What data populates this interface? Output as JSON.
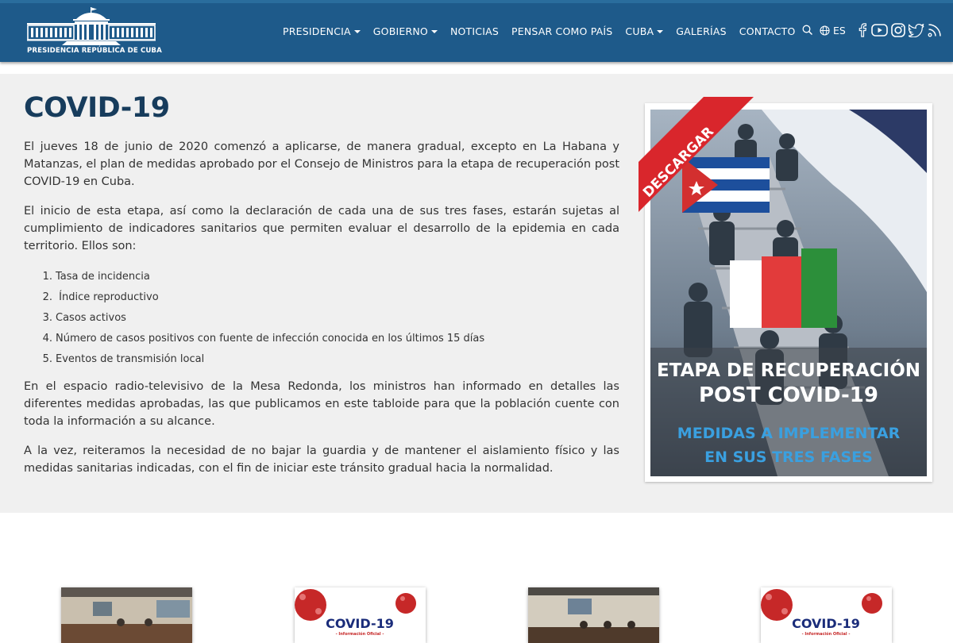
{
  "header": {
    "logo_text": "PRESIDENCIA REPÚBLICA DE CUBA",
    "nav": [
      {
        "label": "PRESIDENCIA",
        "dropdown": true
      },
      {
        "label": "GOBIERNO",
        "dropdown": true
      },
      {
        "label": "NOTICIAS",
        "dropdown": false
      },
      {
        "label": "PENSAR COMO PAÍS",
        "dropdown": false
      },
      {
        "label": "CUBA",
        "dropdown": true
      },
      {
        "label": "GALERÍAS",
        "dropdown": false
      },
      {
        "label": "CONTACTO",
        "dropdown": false
      }
    ],
    "language": "ES",
    "icons": [
      "search-icon",
      "globe-icon",
      "facebook-icon",
      "youtube-icon",
      "instagram-icon",
      "twitter-icon",
      "rss-icon"
    ]
  },
  "article": {
    "title": "COVID-19",
    "paragraphs": [
      "El jueves 18 de junio de 2020 comenzó a aplicarse, de manera gradual, excepto en La Habana y Matanzas, el plan de medidas aprobado por el Consejo de Ministros para la etapa de recuperación post COVID-19 en Cuba.",
      "El inicio de esta etapa, así como la declaración de cada una de sus tres fases, estarán sujetas al cumplimiento de indicadores sanitarios que permiten evaluar el desarrollo de la epidemia en cada territorio. Ellos son:",
      "En el espacio radio-televisivo de la Mesa Redonda, los ministros han informado en detalles las diferentes medidas aprobadas, las que publicamos en este tabloide para que la población cuente con toda la información a su alcance.",
      "A la vez, reiteramos la necesidad de no bajar la guardia y de mantener el aislamiento físico y las medidas sanitarias indicadas, con el fin de iniciar este tránsito gradual hacia la normalidad."
    ],
    "indicators": [
      {
        "num": "1.",
        "text": "Tasa de incidencia"
      },
      {
        "num": "2.",
        "text": " Índice reproductivo"
      },
      {
        "num": "3.",
        "text": "Casos activos"
      },
      {
        "num": "4.",
        "text": "Número de casos positivos con fuente de infección conocida en los últimos 15 días"
      },
      {
        "num": "5.",
        "text": "Eventos de transmisión local"
      }
    ]
  },
  "poster": {
    "ribbon": "DESCARGAR",
    "headline_1": "ETAPA DE RECUPERACIÓN",
    "headline_2": "POST COVID-19",
    "subline_1": "MEDIDAS A IMPLEMENTAR",
    "subline_2": "EN SUS TRES FASES"
  },
  "thumbnails": [
    {
      "type": "photo"
    },
    {
      "type": "covid",
      "label": "COVID-19",
      "sublabel": "- Información Oficial -"
    },
    {
      "type": "photo"
    },
    {
      "type": "covid",
      "label": "COVID-19",
      "sublabel": "- Información Oficial -"
    }
  ],
  "colors": {
    "header_bg": "#1e5a8a",
    "title": "#173c5c",
    "band_bg": "#f0f0f0",
    "poster_ribbon": "#d9262c",
    "poster_sub": "#3aa0e0"
  }
}
